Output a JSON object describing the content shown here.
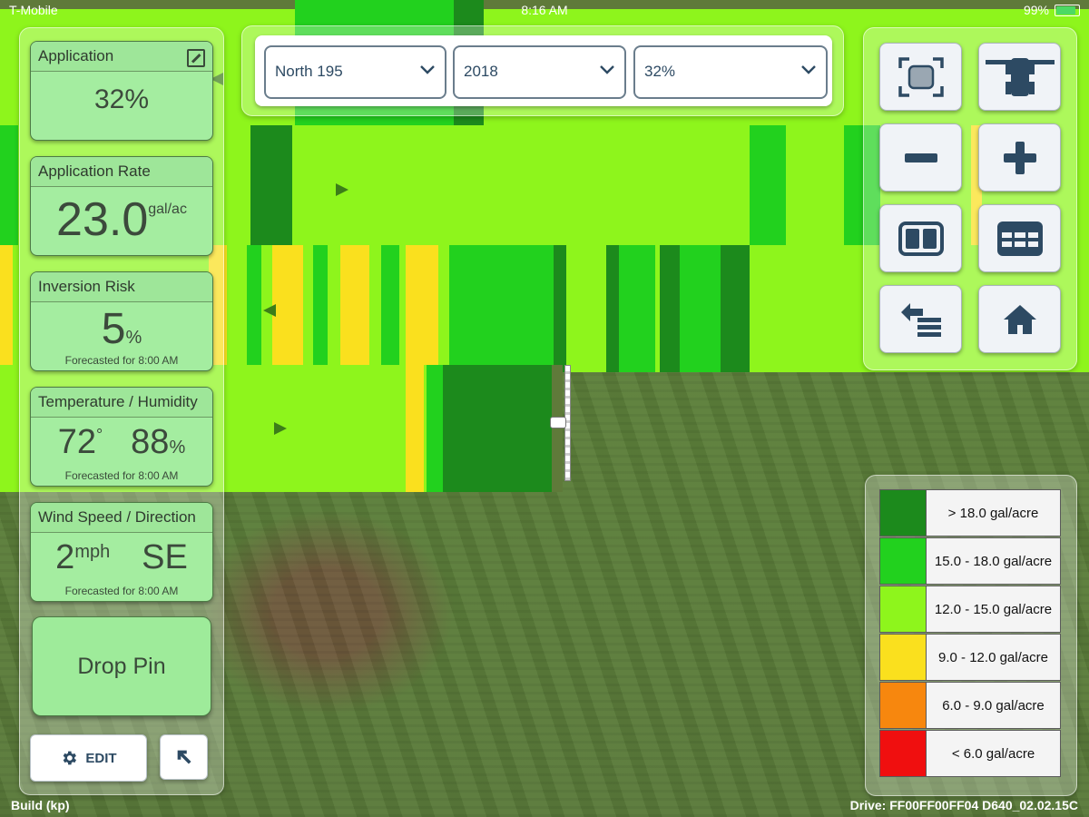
{
  "status_bar": {
    "carrier": "T-Mobile",
    "time": "8:16 AM",
    "battery": "99%"
  },
  "left_panel": {
    "application": {
      "title": "Application",
      "value": "32%"
    },
    "application_rate": {
      "title": "Application Rate",
      "value": "23.0",
      "unit": "gal/ac"
    },
    "inversion_risk": {
      "title": "Inversion Risk",
      "value": "5",
      "unit": "%",
      "forecast": "Forecasted for 8:00 AM"
    },
    "temp_humidity": {
      "title": "Temperature / Humidity",
      "temp": "72",
      "temp_unit": "°",
      "humidity": "88",
      "humidity_unit": "%",
      "forecast": "Forecasted for 8:00 AM"
    },
    "wind": {
      "title": "Wind Speed / Direction",
      "speed": "2",
      "unit": "mph",
      "direction": "SE",
      "forecast": "Forecasted for 8:00 AM"
    },
    "drop_pin": "Drop Pin",
    "edit": "EDIT"
  },
  "dropdowns": {
    "field": "North 195",
    "year": "2018",
    "application": "32%"
  },
  "tool_icons": [
    "fit-screen-icon",
    "tractor-icon",
    "zoom-out-icon",
    "zoom-in-icon",
    "split-view-icon",
    "table-icon",
    "swap-list-icon",
    "home-icon"
  ],
  "legend": [
    {
      "label": "> 18.0 gal/acre",
      "color": "#1c8a1c"
    },
    {
      "label": "15.0 - 18.0 gal/acre",
      "color": "#22d11e"
    },
    {
      "label": "12.0 - 15.0 gal/acre",
      "color": "#8ef51c"
    },
    {
      "label": "9.0 - 12.0 gal/acre",
      "color": "#fae01e"
    },
    {
      "label": "6.0 - 9.0 gal/acre",
      "color": "#f7870e"
    },
    {
      "label": "< 6.0 gal/acre",
      "color": "#f00f0f"
    }
  ],
  "footer": {
    "build": "Build (kp)",
    "drive": "Drive: FF00FF00FF04 D640_02.02.15C"
  }
}
